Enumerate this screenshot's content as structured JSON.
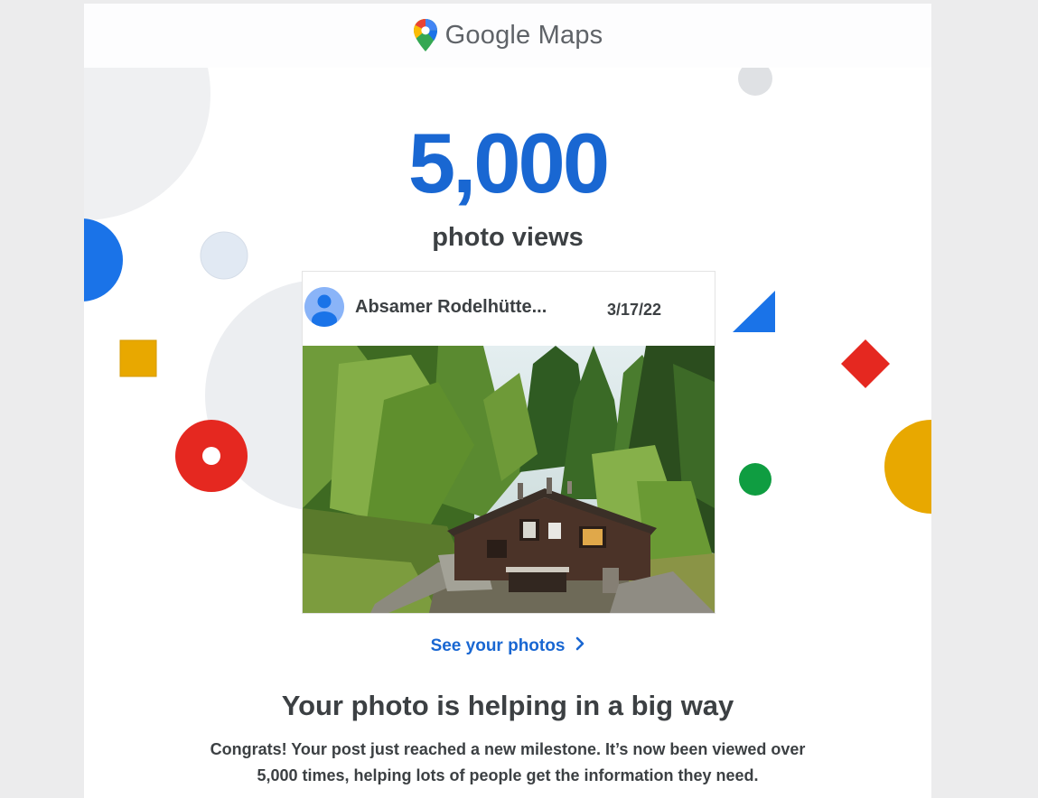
{
  "header": {
    "brand": "Google Maps",
    "logo_icon": "map-pin-icon"
  },
  "milestone": {
    "value": "5,000",
    "label": "photo views"
  },
  "post": {
    "author_icon": "avatar-icon",
    "place_name": "Absamer Rodelhütte...",
    "date": "3/17/22"
  },
  "cta": {
    "label": "See your photos",
    "icon": "chevron-right-icon"
  },
  "message": {
    "headline": "Your photo is helping in a big way",
    "body": "Congrats! Your post just reached a new milestone. It’s now been viewed over 5,000 times, helping lots of people get the information they need."
  },
  "colors": {
    "blue": "#1a73e8",
    "red": "#e52820",
    "yellow": "#e8a800",
    "green": "#0f9d41",
    "metric_blue": "#1967d2"
  }
}
